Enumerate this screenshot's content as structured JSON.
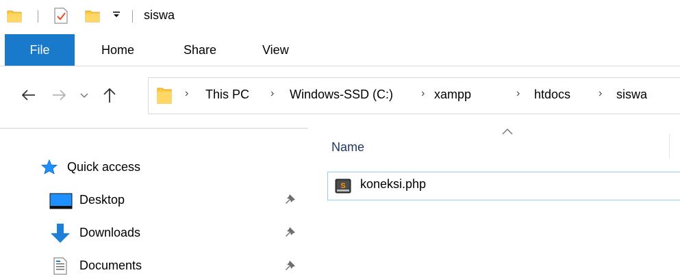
{
  "window": {
    "title": "siswa"
  },
  "ribbon": {
    "tabs": [
      {
        "label": "File"
      },
      {
        "label": "Home"
      },
      {
        "label": "Share"
      },
      {
        "label": "View"
      }
    ]
  },
  "address": {
    "crumbs": [
      "This PC",
      "Windows-SSD (C:)",
      "xampp",
      "htdocs",
      "siswa"
    ]
  },
  "content": {
    "column_name": "Name",
    "files": [
      {
        "name": "koneksi.php",
        "icon": "sublime-text-file-icon"
      }
    ]
  },
  "nav_pane": {
    "quick_access": "Quick access",
    "items": [
      {
        "label": "Desktop",
        "icon": "desktop-icon",
        "pinned": true
      },
      {
        "label": "Downloads",
        "icon": "download-arrow-icon",
        "pinned": true
      },
      {
        "label": "Documents",
        "icon": "documents-icon",
        "pinned": true
      }
    ]
  },
  "colors": {
    "accent": "#1979ca",
    "folder": "#ffc83d",
    "selection_border": "#99c9ef"
  }
}
